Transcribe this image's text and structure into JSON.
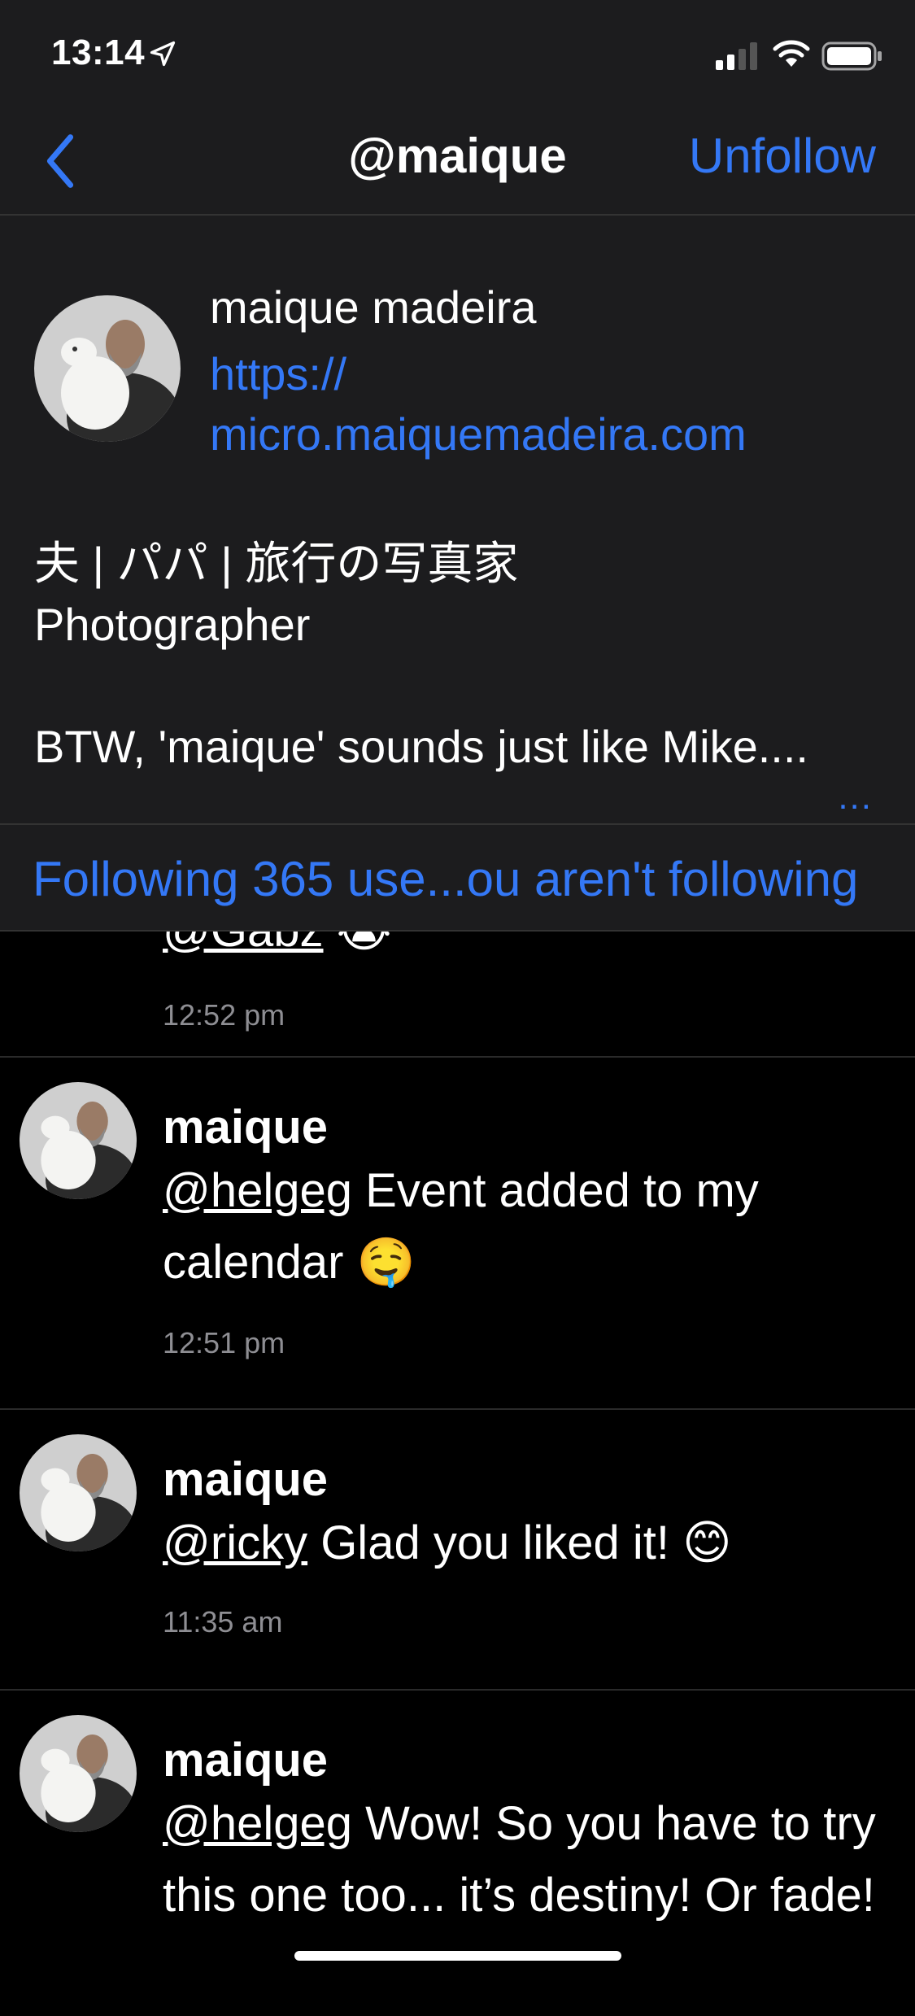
{
  "status": {
    "time": "13:14"
  },
  "nav": {
    "title": "@maique",
    "unfollow_label": "Unfollow"
  },
  "profile": {
    "full_name": "maique madeira",
    "url_line1": "https://",
    "url_line2": "micro.maiquemadeira.com",
    "bio_line1": "夫 | パパ | 旅行の写真家",
    "bio_line2": "Photographer",
    "bio_line3": "BTW, 'maique' sounds just like Mike....",
    "more_label": "..."
  },
  "following_label": "Following 365 use...ou aren't following",
  "feed": {
    "cut_post": {
      "mention": "@Gabz",
      "emoji": "😭",
      "time": "12:52 pm"
    },
    "posts": [
      {
        "name": "maique",
        "mention": "@helgeg",
        "text": " Event added to my calendar 🤤",
        "time": "12:51 pm"
      },
      {
        "name": "maique",
        "mention": "@ricky",
        "text": " Glad you liked it! 😊",
        "time": "11:35 am"
      },
      {
        "name": "maique",
        "mention": "@helgeg",
        "text": " Wow! So you have to try this one too... it’s destiny! Or fade!",
        "time": ""
      }
    ]
  },
  "colors": {
    "accent": "#3478f6",
    "header_bg": "#1c1c1e",
    "feed_bg": "#000000",
    "timestamp": "#8e8e93"
  }
}
